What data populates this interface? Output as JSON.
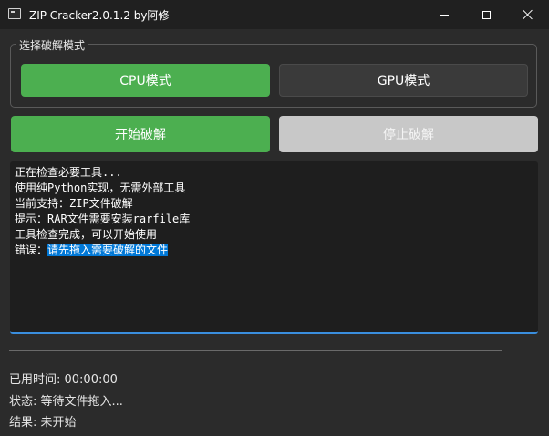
{
  "window": {
    "title": "ZIP Cracker2.0.1.2 by阿修",
    "controls": [
      "minimize-icon",
      "maximize-icon",
      "close-icon"
    ]
  },
  "mode_group": {
    "title": "选择破解模式",
    "cpu_label": "CPU模式",
    "gpu_label": "GPU模式",
    "selected": "CPU模式"
  },
  "actions": {
    "start_label": "开始破解",
    "stop_label": "停止破解"
  },
  "log": {
    "lines": [
      "正在检查必要工具...",
      "使用纯Python实现，无需外部工具",
      "当前支持：ZIP文件破解",
      "提示：RAR文件需要安装rarfile库",
      "工具检查完成，可以开始使用"
    ],
    "error_prefix": "错误：",
    "error_text": "请先拖入需要破解的文件"
  },
  "status": {
    "elapsed": "已用时间: 00:00:00",
    "state": "状态: 等待文件拖入...",
    "result": "结果: 未开始"
  },
  "colors": {
    "accent_green": "#4caf50",
    "disabled_gray": "#c8c8c8",
    "selection_blue": "#0078d7",
    "focus_blue": "#3a8ede"
  }
}
